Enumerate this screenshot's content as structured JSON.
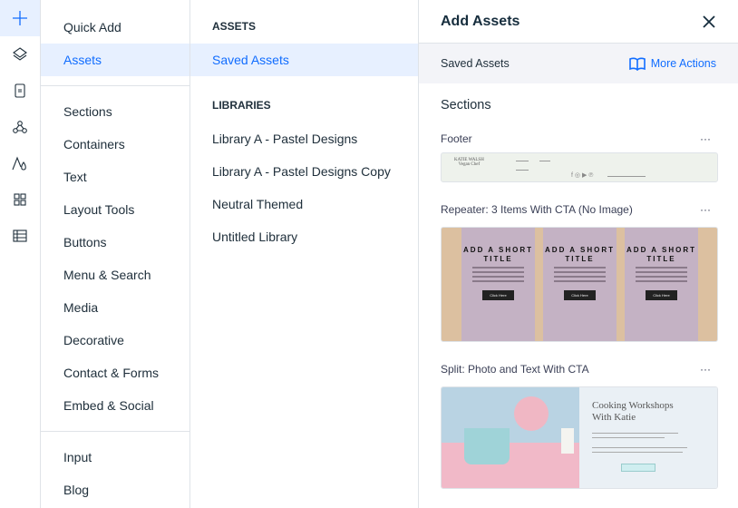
{
  "rail": {
    "icons": [
      "plus-icon",
      "layers-icon",
      "page-icon",
      "connections-icon",
      "text-theme-icon",
      "apps-grid-icon",
      "table-icon"
    ]
  },
  "categories": {
    "top": [
      {
        "label": "Quick Add"
      },
      {
        "label": "Assets",
        "selected": true
      }
    ],
    "middle": [
      "Sections",
      "Containers",
      "Text",
      "Layout Tools",
      "Buttons",
      "Menu & Search",
      "Media",
      "Decorative",
      "Contact & Forms",
      "Embed & Social"
    ],
    "bottom": [
      "Input",
      "Blog"
    ]
  },
  "assets": {
    "header": "ASSETS",
    "saved": "Saved Assets",
    "libraries_header": "LIBRARIES",
    "libraries": [
      "Library A - Pastel Designs",
      "Library A - Pastel Designs Copy",
      "Neutral Themed",
      "Untitled Library"
    ]
  },
  "panel": {
    "title": "Add Assets",
    "subtitle": "Saved Assets",
    "more_actions": "More Actions",
    "section_title": "Sections",
    "items": [
      {
        "name": "Footer",
        "brand": "KATIE WALSH",
        "tagline": "Vegan Chef"
      },
      {
        "name": "Repeater: 3 Items With CTA (No Image)",
        "card_title": "ADD A SHORT TITLE",
        "card_button": "Click Here"
      },
      {
        "name": "Split: Photo and Text With CTA",
        "heading": "Cooking Workshops With Katie"
      }
    ]
  },
  "colors": {
    "accent": "#116dff",
    "selected_bg": "#e7f0ff"
  }
}
